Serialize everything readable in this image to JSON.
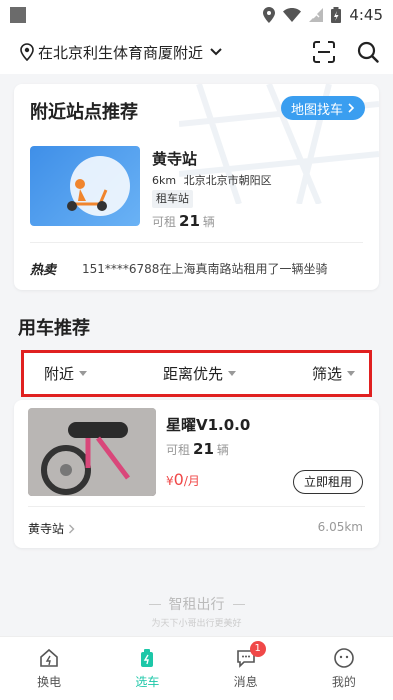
{
  "status_bar": {
    "time": "4:45"
  },
  "top_bar": {
    "location": "在北京利生体育商厦附近"
  },
  "nearby": {
    "title": "附近站点推荐",
    "map_button": "地图找车",
    "station": {
      "name": "黄寺站",
      "distance": "6km",
      "address": "北京北京市朝阳区",
      "tag": "租车站",
      "avail_label": "可租",
      "avail_count": "21",
      "avail_unit": "辆"
    },
    "hot_label": "热卖",
    "hot_text": "151****6788在上海真南路站租用了一辆坐骑"
  },
  "recommend": {
    "title": "用车推荐",
    "filters": [
      "附近",
      "距离优先",
      "筛选"
    ],
    "bike": {
      "name": "星曜V1.0.0",
      "avail_label": "可租",
      "avail_count": "21",
      "avail_unit": "辆",
      "currency": "¥",
      "price": "0",
      "price_unit": "/月",
      "rent_button": "立即租用",
      "station": "黄寺站",
      "distance": "6.05km"
    }
  },
  "brand": {
    "name": "智租出行",
    "slogan": "为天下小哥出行更美好"
  },
  "tabs": [
    {
      "label": "换电",
      "icon": "battery-swap-icon"
    },
    {
      "label": "选车",
      "icon": "vehicle-select-icon"
    },
    {
      "label": "消息",
      "icon": "message-icon",
      "badge": "1"
    },
    {
      "label": "我的",
      "icon": "profile-icon"
    }
  ],
  "colors": {
    "accent": "#1cc7a8",
    "blue": "#3a9ef0",
    "highlight": "#e02020",
    "price": "#f04848"
  }
}
